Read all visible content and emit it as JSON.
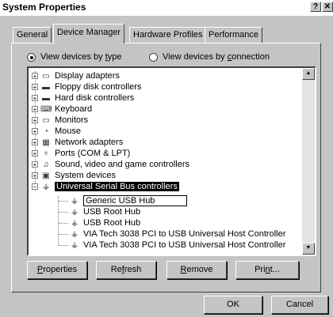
{
  "window": {
    "title": "System Properties",
    "help_glyph": "?",
    "close_glyph": "✕"
  },
  "tabs": [
    "General",
    "Device Manager",
    "Hardware Profiles",
    "Performance"
  ],
  "active_tab": "Device Manager",
  "view_options": {
    "by_type": {
      "pre": "View devices by ",
      "hot": "t",
      "post": "ype",
      "selected": true
    },
    "by_connection": {
      "pre": "View devices by ",
      "hot": "c",
      "post": "onnection",
      "selected": false
    }
  },
  "tree": [
    {
      "label": "Display adapters",
      "icon": "monitor-icon",
      "expander": "+"
    },
    {
      "label": "Floppy disk controllers",
      "icon": "disk-icon",
      "expander": "+"
    },
    {
      "label": "Hard disk controllers",
      "icon": "disk-icon",
      "expander": "+"
    },
    {
      "label": "Keyboard",
      "icon": "keyboard-icon",
      "expander": "+"
    },
    {
      "label": "Monitors",
      "icon": "monitor-icon",
      "expander": "+"
    },
    {
      "label": "Mouse",
      "icon": "mouse-icon",
      "expander": "+"
    },
    {
      "label": "Network adapters",
      "icon": "network-icon",
      "expander": "+"
    },
    {
      "label": "Ports (COM & LPT)",
      "icon": "port-icon",
      "expander": "+"
    },
    {
      "label": "Sound, video and game controllers",
      "icon": "sound-icon",
      "expander": "+"
    },
    {
      "label": "System devices",
      "icon": "system-icon",
      "expander": "+"
    },
    {
      "label": "Universal Serial Bus controllers",
      "icon": "usb-icon",
      "expander": "−",
      "selected": true
    }
  ],
  "usb_children": [
    {
      "label": "Generic USB Hub",
      "icon": "usb-icon",
      "focused": true
    },
    {
      "label": "USB Root Hub",
      "icon": "usb-icon"
    },
    {
      "label": "USB Root Hub",
      "icon": "usb-icon"
    },
    {
      "label": "VIA Tech 3038 PCI to USB Universal Host Controller",
      "icon": "usb-icon"
    },
    {
      "label": "VIA Tech 3038 PCI to USB Universal Host Controller",
      "icon": "usb-icon"
    }
  ],
  "buttons": {
    "properties": {
      "pre": "",
      "hot": "P",
      "post": "roperties"
    },
    "refresh": {
      "pre": "Re",
      "hot": "f",
      "post": "resh"
    },
    "remove": {
      "pre": "",
      "hot": "R",
      "post": "emove"
    },
    "print": {
      "pre": "Pri",
      "hot": "n",
      "post": "t..."
    }
  },
  "dialog_buttons": {
    "ok": "OK",
    "cancel": "Cancel"
  },
  "scroll_glyphs": {
    "up": "▲",
    "down": "▼"
  }
}
